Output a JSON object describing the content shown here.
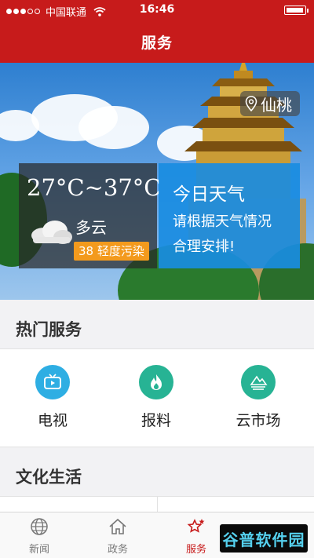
{
  "status_bar": {
    "carrier": "中国联通",
    "time": "16:46"
  },
  "nav": {
    "title": "服务"
  },
  "banner": {
    "location": "仙桃",
    "temperature": "27°C~37°C",
    "condition": "多云",
    "aqi": "38 轻度污染",
    "today_title": "今日天气",
    "advice_line1": "请根据天气情况",
    "advice_line2": "合理安排!"
  },
  "hot_services": {
    "title": "热门服务",
    "items": [
      {
        "label": "电视",
        "icon": "tv-icon",
        "color": "#2eaee3"
      },
      {
        "label": "报料",
        "icon": "flame-icon",
        "color": "#27b394"
      },
      {
        "label": "云市场",
        "icon": "market-icon",
        "color": "#27b394"
      }
    ]
  },
  "culture": {
    "title": "文化生活"
  },
  "tabbar": {
    "tabs": [
      {
        "label": "新闻",
        "icon": "globe-icon"
      },
      {
        "label": "政务",
        "icon": "home-icon"
      },
      {
        "label": "服务",
        "icon": "star-icon",
        "active": true
      }
    ]
  },
  "watermark": {
    "text": "谷普软件园"
  },
  "colors": {
    "brand_red": "#c71b1b",
    "weather_blue": "#198ce1",
    "aqi_orange": "#f39a1d"
  }
}
